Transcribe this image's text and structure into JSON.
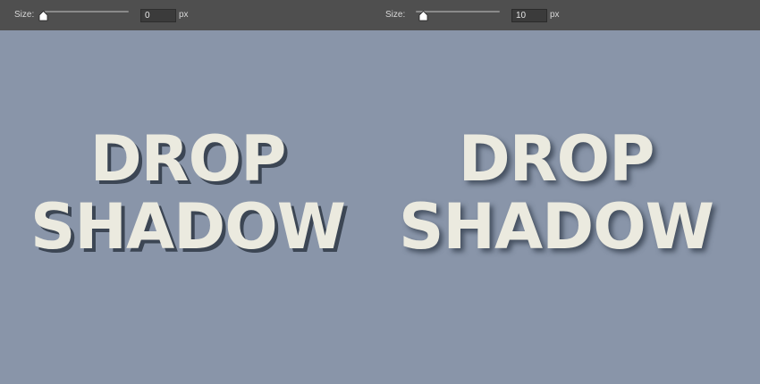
{
  "toolbar": {
    "left": {
      "label": "Size:",
      "value": "0",
      "unit": "px",
      "slider_level": 0
    },
    "right": {
      "label": "Size:",
      "value": "10",
      "unit": "px",
      "slider_level": 0.1
    }
  },
  "canvas": {
    "background_color": "#8995a9",
    "text_color": "#ebeadf",
    "shadow_color": "#3c4654",
    "left_text": {
      "line1": "DROP",
      "line2": "SHADOW"
    },
    "right_text": {
      "line1": "DROP",
      "line2": "SHADOW"
    }
  }
}
